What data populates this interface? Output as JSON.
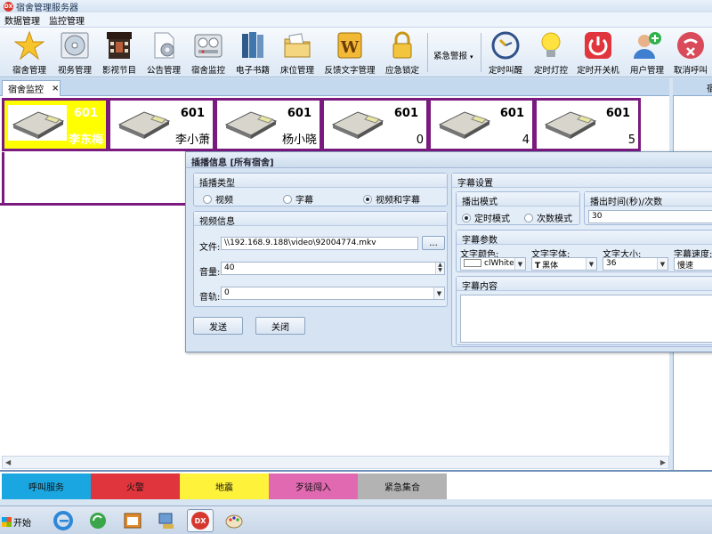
{
  "window": {
    "title": "宿舍管理服务器",
    "logo_text": "DX"
  },
  "menu": {
    "items": [
      "数据管理",
      "监控管理"
    ]
  },
  "toolbar": {
    "buttons": [
      {
        "label": "宿舍管理",
        "icon": "star-icon"
      },
      {
        "label": "视务管理",
        "icon": "disc-icon"
      },
      {
        "label": "影视节目",
        "icon": "film-icon"
      },
      {
        "label": "公告管理",
        "icon": "document-gear-icon"
      },
      {
        "label": "宿舍监控",
        "icon": "monitor-gauges-icon"
      },
      {
        "label": "电子书籍",
        "icon": "books-icon"
      },
      {
        "label": "床位管理",
        "icon": "folders-icon"
      },
      {
        "label": "反馈文字管理",
        "icon": "word-box-icon"
      },
      {
        "label": "应急锁定",
        "icon": "lock-icon"
      }
    ],
    "urgent_label": "紧急警报",
    "right_buttons": [
      {
        "label": "定时叫醒",
        "icon": "clock-icon"
      },
      {
        "label": "定时灯控",
        "icon": "bulb-icon"
      },
      {
        "label": "定时开关机",
        "icon": "power-icon"
      },
      {
        "label": "用户管理",
        "icon": "user-add-icon"
      },
      {
        "label": "取消呼叫",
        "icon": "cancel-call-icon"
      }
    ]
  },
  "tabs": {
    "active": "宿舍监控",
    "close": "×",
    "right_panel_title": "宿"
  },
  "rooms": [
    {
      "number": "601",
      "occupant": "李东梅",
      "selected": true
    },
    {
      "number": "601",
      "occupant": "李小萧",
      "selected": false
    },
    {
      "number": "601",
      "occupant": "杨小晓",
      "selected": false
    },
    {
      "number": "601",
      "occupant": "0",
      "selected": false
    },
    {
      "number": "601",
      "occupant": "4",
      "selected": false
    },
    {
      "number": "601",
      "occupant": "5",
      "selected": false
    }
  ],
  "alarm_buttons": [
    {
      "label": "呼叫服务",
      "color": "#1aa6e0"
    },
    {
      "label": "火警",
      "color": "#e0353c"
    },
    {
      "label": "地震",
      "color": "#fff23a"
    },
    {
      "label": "歹徒闯入",
      "color": "#e069b1"
    },
    {
      "label": "紧急集合",
      "color": "#b3b3b3"
    }
  ],
  "taskbar": {
    "start_label": "开始",
    "dx_label": "DX"
  },
  "dialog": {
    "title": "插播信息 [所有宿舍]",
    "play_type": {
      "title": "插播类型",
      "options": [
        "视频",
        "字幕",
        "视频和字幕"
      ],
      "selected": "视频和字幕"
    },
    "video": {
      "title": "视频信息",
      "file_label": "文件:",
      "file_value": "\\\\192.168.9.188\\video\\92004774.mkv",
      "browse_label": "...",
      "volume_label": "音量:",
      "volume_value": "40",
      "track_label": "音轨:",
      "track_value": "0"
    },
    "send_label": "发送",
    "close_label": "关闭",
    "subtitle": {
      "title": "字幕设置",
      "mode_title": "播出模式",
      "modes": [
        "定时模式",
        "次数模式"
      ],
      "mode_selected": "定时模式",
      "time_title": "播出时间(秒)/次数",
      "time_value": "30",
      "params_title": "字幕参数",
      "color_label": "文字颜色:",
      "color_value": "clWhite",
      "font_label": "文字字体:",
      "font_value": "黑体",
      "size_label": "文字大小:",
      "size_value": "36",
      "speed_label": "字幕速度:",
      "speed_value": "慢速",
      "content_title": "字幕内容"
    }
  }
}
